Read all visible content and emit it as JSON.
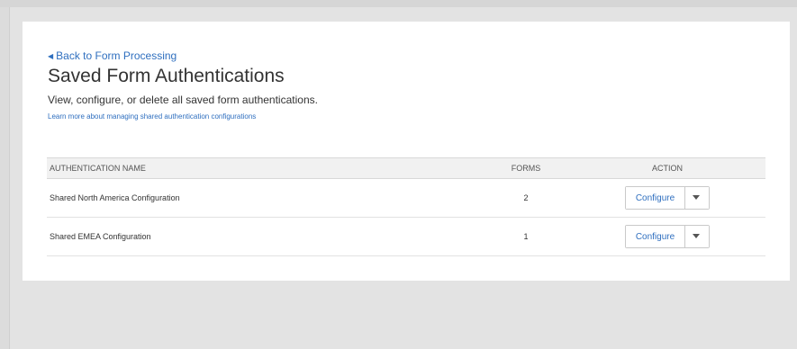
{
  "nav": {
    "back_label": "Back to Form Processing"
  },
  "header": {
    "title": "Saved Form Authentications",
    "description": "View, configure, or delete all saved form authentications.",
    "learn_more": "Learn more about managing shared authentication configurations"
  },
  "table": {
    "columns": [
      "AUTHENTICATION NAME",
      "FORMS",
      "ACTION"
    ],
    "rows": [
      {
        "name": "Shared North America Configuration",
        "forms": "2",
        "action_label": "Configure"
      },
      {
        "name": "Shared EMEA Configuration",
        "forms": "1",
        "action_label": "Configure"
      }
    ]
  },
  "icons": {
    "back": "caret-left-icon",
    "dropdown": "caret-down-icon"
  },
  "colors": {
    "link": "#2f6fbf",
    "background": "#e3e3e3",
    "card": "#ffffff"
  }
}
